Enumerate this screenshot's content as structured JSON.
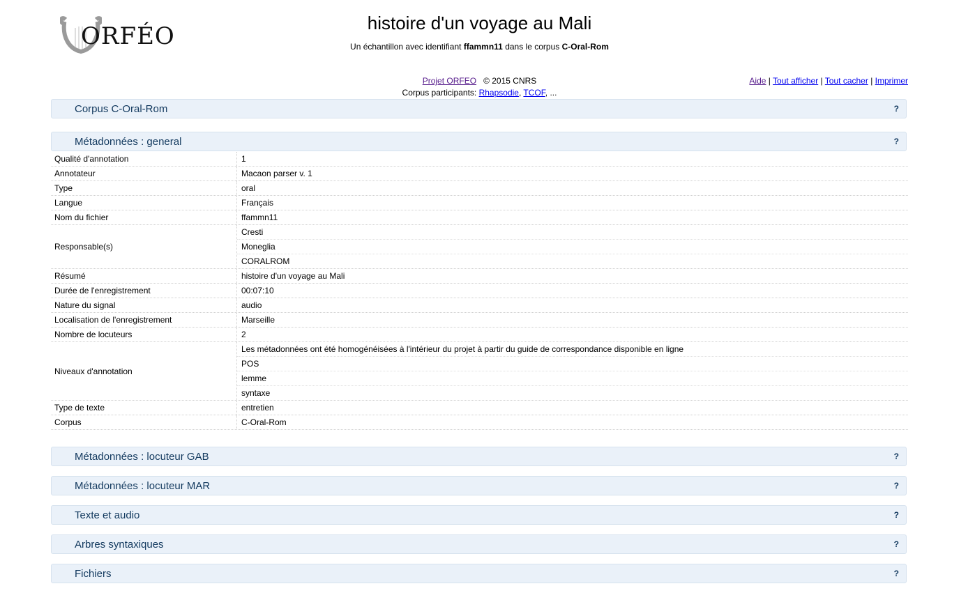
{
  "logo": {
    "text": "ORFÉO"
  },
  "header": {
    "title": "histoire d'un voyage au Mali",
    "subtitle_prefix": "Un échantillon avec identifiant",
    "sample_id": "ffammn11",
    "subtitle_middle": "dans le corpus",
    "corpus_name": "C-Oral-Rom"
  },
  "project": {
    "link": "Projet ORFEO",
    "copyright": "© 2015 CNRS",
    "participants_label": "Corpus participants:",
    "participants": [
      "Rhapsodie",
      "TCOF"
    ],
    "participants_more": "..."
  },
  "toplinks": {
    "aide": "Aide",
    "tout_afficher": "Tout afficher",
    "tout_cacher": "Tout cacher",
    "imprimer": "Imprimer",
    "separator": "|"
  },
  "sections": {
    "corpus": "Corpus C-Oral-Rom",
    "general": "Métadonnées : general",
    "gab": "Métadonnées : locuteur GAB",
    "mar": "Métadonnées : locuteur MAR",
    "texte": "Texte et audio",
    "arbres": "Arbres syntaxiques",
    "fichiers": "Fichiers",
    "help": "?"
  },
  "metadata": [
    {
      "key": "Qualité d'annotation",
      "values": [
        "1"
      ]
    },
    {
      "key": "Annotateur",
      "values": [
        "Macaon parser v. 1"
      ]
    },
    {
      "key": "Type",
      "values": [
        "oral"
      ]
    },
    {
      "key": "Langue",
      "values": [
        "Français"
      ]
    },
    {
      "key": "Nom du fichier",
      "values": [
        "ffammn11"
      ]
    },
    {
      "key": "Responsable(s)",
      "values": [
        "Cresti",
        "Moneglia",
        "CORALROM"
      ]
    },
    {
      "key": "Résumé",
      "values": [
        "histoire d'un voyage au Mali"
      ]
    },
    {
      "key": "Durée de l'enregistrement",
      "values": [
        "00:07:10"
      ]
    },
    {
      "key": "Nature du signal",
      "values": [
        "audio"
      ]
    },
    {
      "key": "Localisation de l'enregistrement",
      "values": [
        "Marseille"
      ]
    },
    {
      "key": "Nombre de locuteurs",
      "values": [
        "2"
      ]
    },
    {
      "key": "Niveaux d'annotation",
      "values": [
        "Les métadonnées ont été homogénéisées à l'intérieur du projet à partir du guide de correspondance disponible en ligne",
        "POS",
        "lemme",
        "syntaxe"
      ]
    },
    {
      "key": "Type de texte",
      "values": [
        "entretien"
      ]
    },
    {
      "key": "Corpus",
      "values": [
        "C-Oral-Rom"
      ]
    }
  ]
}
